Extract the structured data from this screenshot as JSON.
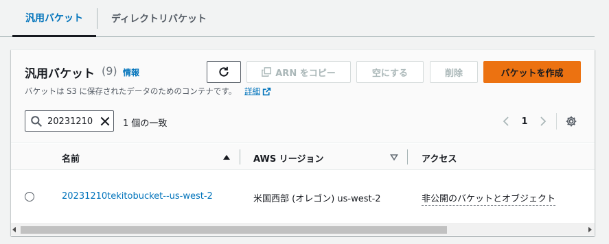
{
  "tabs": {
    "active": "汎用バケット",
    "inactive": "ディレクトリバケット"
  },
  "header": {
    "title": "汎用バケット",
    "count": "(9)",
    "info_link": "情報",
    "description": "バケットは S3 に保存されたデータのためのコンテナです。",
    "learn_more": "詳細"
  },
  "actions": {
    "copy_arn": "ARN をコピー",
    "empty": "空にする",
    "delete": "削除",
    "create": "バケットを作成"
  },
  "filter": {
    "value": "20231210",
    "match_text": "1 個の一致"
  },
  "pagination": {
    "current_page": "1"
  },
  "table": {
    "columns": [
      "名前",
      "AWS リージョン",
      "アクセス"
    ],
    "rows": [
      {
        "name": "20231210tekitobucket--us-west-2",
        "region": "米国西部 (オレゴン) us-west-2",
        "access": "非公開のバケットとオブジェクト"
      }
    ]
  },
  "colors": {
    "link": "#0073bb",
    "primary_button": "#ec7211",
    "text": "#16191f",
    "muted": "#545b64"
  }
}
